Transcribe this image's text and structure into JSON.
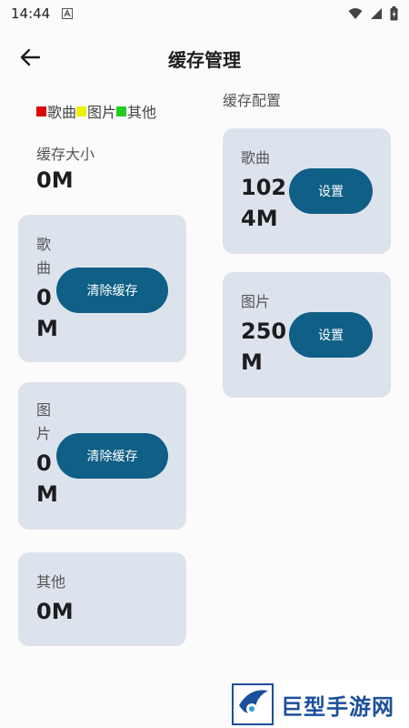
{
  "status": {
    "time": "14:44"
  },
  "header": {
    "title": "缓存管理"
  },
  "legend": [
    {
      "label": "歌曲",
      "color": "#e00000"
    },
    {
      "label": "图片",
      "color": "#f0f000"
    },
    {
      "label": "其他",
      "color": "#22cc22"
    }
  ],
  "cache_size": {
    "label": "缓存大小",
    "value": "0M"
  },
  "songs_card": {
    "name_line1": "歌",
    "name_line2": "曲",
    "value_line1": "0",
    "value_line2": "M",
    "button": "清除缓存"
  },
  "images_card": {
    "name_line1": "图",
    "name_line2": "片",
    "value_line1": "0",
    "value_line2": "M",
    "button": "清除缓存"
  },
  "other_card": {
    "name": "其他",
    "value": "0M"
  },
  "config": {
    "label": "缓存配置",
    "songs": {
      "name": "歌曲",
      "value_line1": "102",
      "value_line2": "4M",
      "button": "设置"
    },
    "images": {
      "name": "图片",
      "value_line1": "250",
      "value_line2": "M",
      "button": "设置"
    }
  },
  "watermark": {
    "text": "巨型手游网"
  },
  "colors": {
    "card_bg": "#dde3ec",
    "button_bg": "#0f5f86",
    "watermark": "#1b4f9c"
  }
}
